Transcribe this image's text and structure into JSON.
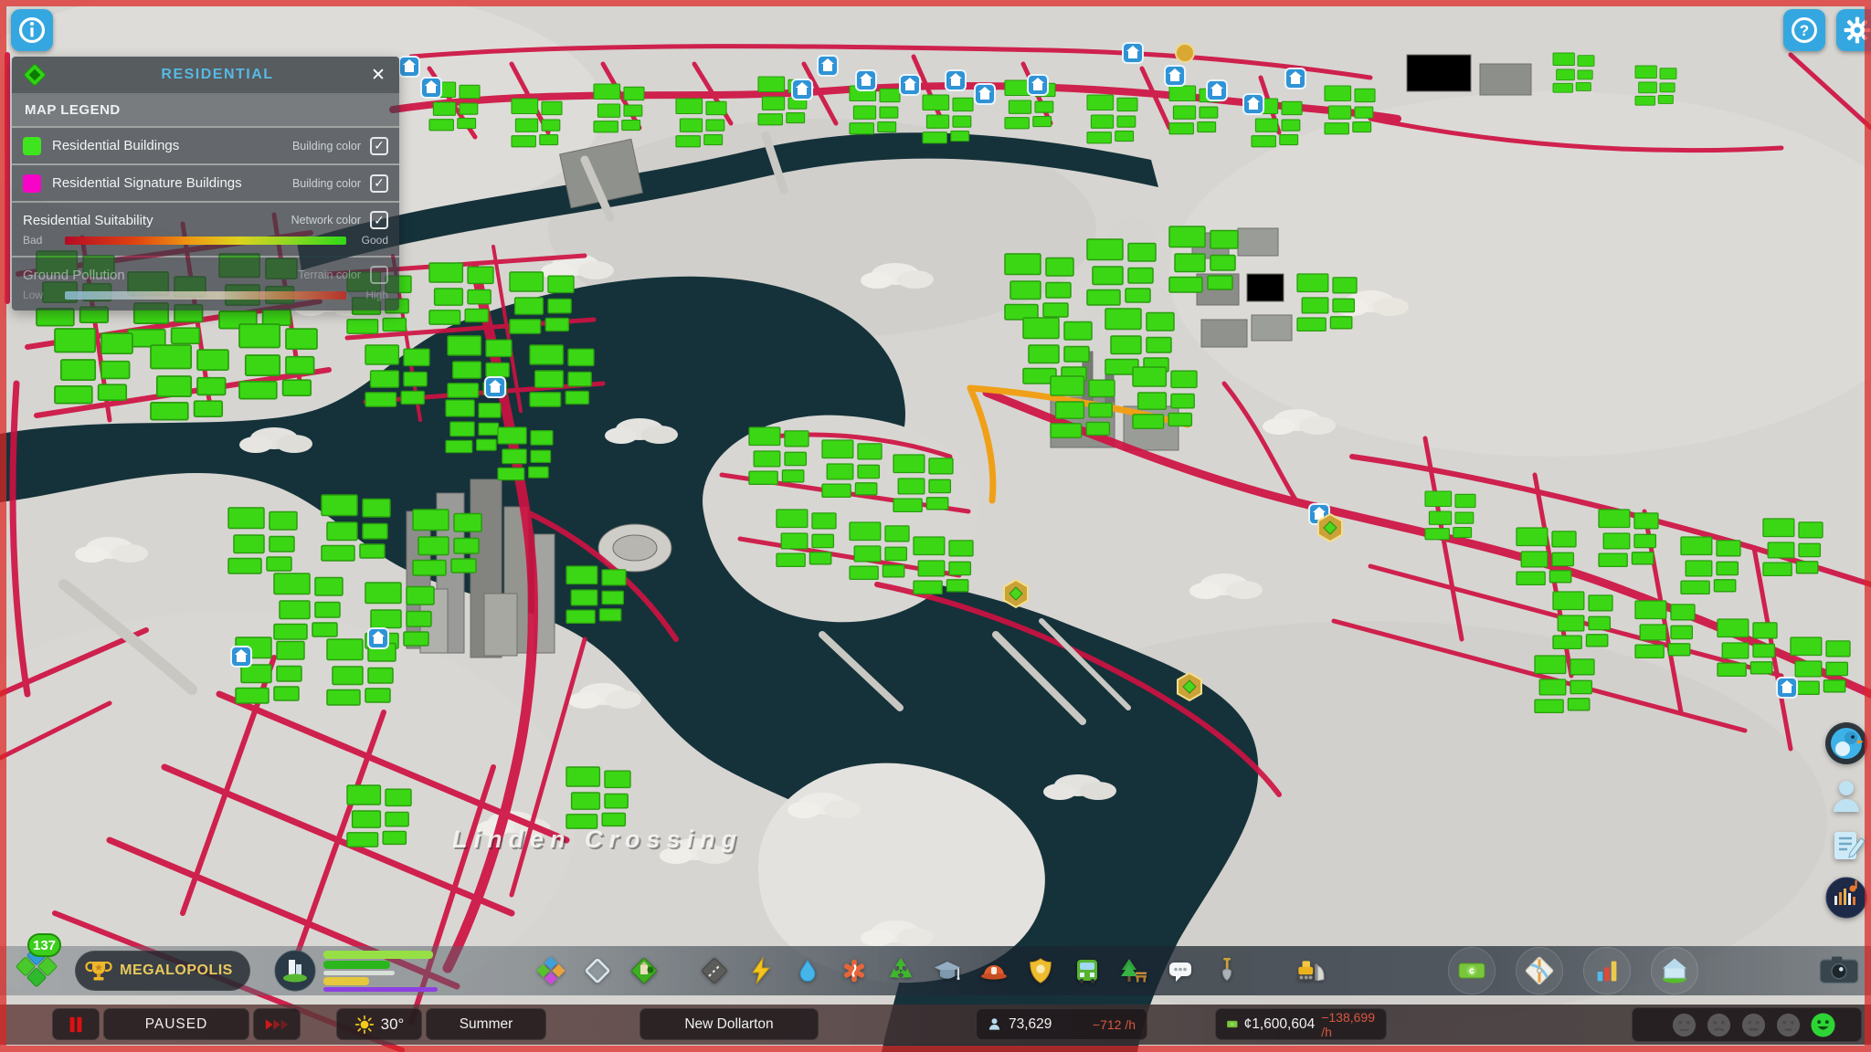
{
  "hud": {
    "info_button": "i",
    "help_button": "?",
    "close_button": "✕"
  },
  "legend_panel": {
    "title": "RESIDENTIAL",
    "section_title": "MAP LEGEND",
    "rows": [
      {
        "label": "Residential Buildings",
        "mode": "Building color",
        "check": "✓",
        "swatch_style": "background:#3ee51e"
      },
      {
        "label": "Residential Signature Buildings",
        "mode": "Building color",
        "check": "✓",
        "swatch_style": "background:#f704c8"
      },
      {
        "label": "Residential Suitability",
        "mode": "Network color",
        "check": "✓",
        "scale_min": "Bad",
        "scale_max": "Good"
      },
      {
        "label": "Ground Pollution",
        "mode": "Terrain color",
        "check": "",
        "scale_min": "Low",
        "scale_max": "High"
      }
    ]
  },
  "map": {
    "district_label": "Linden Crossing"
  },
  "progression": {
    "level": "137",
    "milestone": "MEGALOPOLIS"
  },
  "demand": {
    "bars": [
      {
        "name": "residential-demand",
        "style": "width:96%;background:#96e045"
      },
      {
        "name": "commercial-demand",
        "style": "width:58%;background:#2ab61c"
      },
      {
        "name": "medium-demand",
        "style": "width:62%;background:#d8ded8"
      },
      {
        "name": "industrial-demand",
        "style": "width:40%;background:#e5c83c"
      },
      {
        "name": "office-demand",
        "style": "width:100%;background:#8d41e0"
      }
    ]
  },
  "toolbar": {
    "items": [
      "zones",
      "districts",
      "landscaping",
      "roads",
      "electricity",
      "water-sewage",
      "healthcare",
      "garbage",
      "education",
      "fire-rescue",
      "police",
      "transportation",
      "parks-recreation",
      "communications",
      "terraforming",
      "bulldozer"
    ],
    "info_items": [
      "economy",
      "map-tiles",
      "statistics",
      "city-progression"
    ],
    "photo_item": "photo-mode"
  },
  "side_buttons": [
    "chirper",
    "follow-citizen",
    "journal",
    "radio"
  ],
  "status_bar": {
    "pause_state": "PAUSED",
    "temperature": "30°",
    "season": "Summer",
    "city_name": "New Dollarton",
    "population": "73,629",
    "population_rate": "−712 /h",
    "money": "¢1,600,604",
    "money_rate": "−138,699 /h"
  },
  "colors": {
    "accent_blue": "#35a7e0",
    "panel_title_cyan": "#56b9e4",
    "legend_green": "#3ee51e",
    "legend_magenta": "#f704c8",
    "road_crimson": "#ce1243",
    "water_teal": "#15323a",
    "building_green": "#3bd715",
    "milestone_gold": "#e9c95e",
    "paused_red": "#dd1111",
    "negative_rate": "#d8573f",
    "happy_green": "#2ed435"
  }
}
